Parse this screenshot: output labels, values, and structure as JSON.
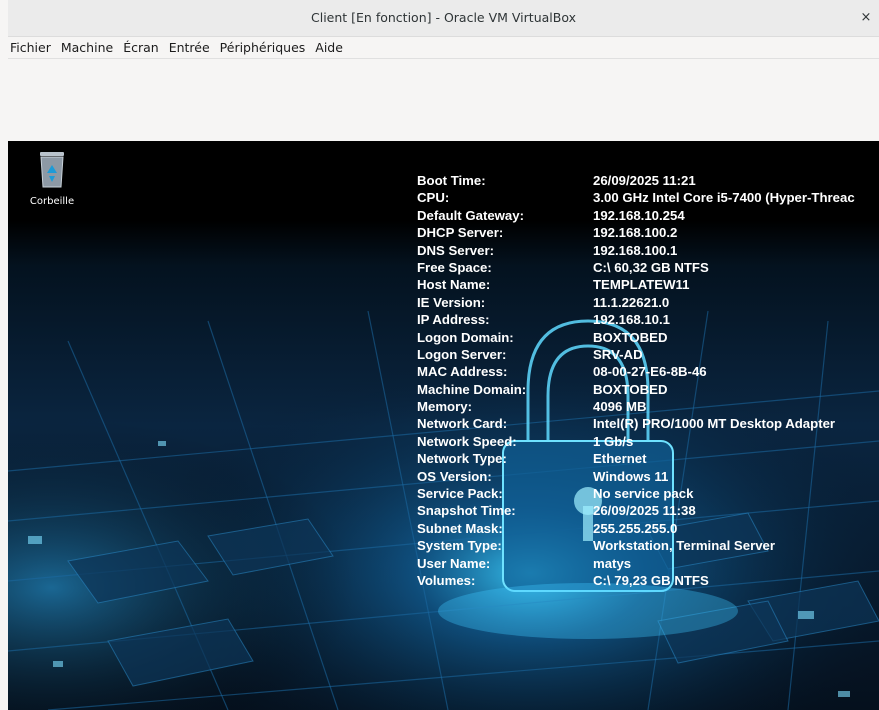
{
  "window": {
    "title": "Client [En fonction] - Oracle VM VirtualBox",
    "close_label": "×"
  },
  "menubar": {
    "items": [
      {
        "label": "Fichier"
      },
      {
        "label": "Machine"
      },
      {
        "label": "Écran"
      },
      {
        "label": "Entrée"
      },
      {
        "label": "Périphériques"
      },
      {
        "label": "Aide"
      }
    ]
  },
  "desktop": {
    "recycle_bin_label": "Corbeille",
    "accent_color": "#1e9bd7"
  },
  "bginfo": {
    "rows": [
      {
        "key": "Boot Time:",
        "value": "26/09/2025 11:21"
      },
      {
        "key": "CPU:",
        "value": "3.00 GHz Intel Core i5-7400 (Hyper-Threac"
      },
      {
        "key": "Default Gateway:",
        "value": "192.168.10.254"
      },
      {
        "key": "DHCP Server:",
        "value": "192.168.100.2"
      },
      {
        "key": "DNS Server:",
        "value": "192.168.100.1"
      },
      {
        "key": "Free Space:",
        "value": "C:\\ 60,32 GB NTFS"
      },
      {
        "key": "Host Name:",
        "value": "TEMPLATEW11"
      },
      {
        "key": "IE Version:",
        "value": "11.1.22621.0"
      },
      {
        "key": "IP Address:",
        "value": "192.168.10.1"
      },
      {
        "key": "Logon Domain:",
        "value": "BOXTOBED"
      },
      {
        "key": "Logon Server:",
        "value": "SRV-AD"
      },
      {
        "key": "MAC Address:",
        "value": "08-00-27-E6-8B-46"
      },
      {
        "key": "Machine Domain:",
        "value": "BOXTOBED"
      },
      {
        "key": "Memory:",
        "value": "4096 MB"
      },
      {
        "key": "Network Card:",
        "value": "Intel(R) PRO/1000 MT Desktop Adapter"
      },
      {
        "key": "Network Speed:",
        "value": "1 Gb/s"
      },
      {
        "key": "Network Type:",
        "value": "Ethernet"
      },
      {
        "key": "OS Version:",
        "value": "Windows 11"
      },
      {
        "key": "Service Pack:",
        "value": "No service pack"
      },
      {
        "key": "Snapshot Time:",
        "value": "26/09/2025 11:38"
      },
      {
        "key": "Subnet Mask:",
        "value": "255.255.255.0"
      },
      {
        "key": "System Type:",
        "value": "Workstation, Terminal Server"
      },
      {
        "key": "User Name:",
        "value": "matys"
      },
      {
        "key": "Volumes:",
        "value": "C:\\ 79,23 GB NTFS"
      }
    ]
  }
}
